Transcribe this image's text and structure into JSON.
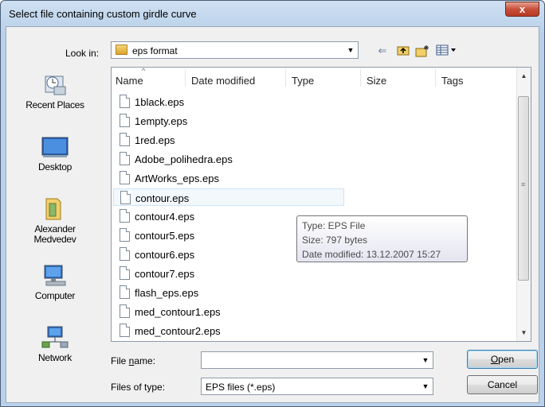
{
  "window": {
    "title": "Select file containing custom girdle curve",
    "close_glyph": "x"
  },
  "lookin": {
    "label": "Look in:",
    "value": "eps format",
    "toolbar": [
      {
        "name": "back-icon",
        "glyph": "⇐"
      },
      {
        "name": "up-folder-icon",
        "glyph": "⮤"
      },
      {
        "name": "new-folder-icon",
        "glyph": "✱"
      },
      {
        "name": "view-menu-icon",
        "glyph": "▦▾"
      }
    ]
  },
  "places": [
    {
      "label": "Recent Places",
      "icon": "recent-places-icon"
    },
    {
      "label": "Desktop",
      "icon": "desktop-icon"
    },
    {
      "label": "Alexander\nMedvedev",
      "icon": "user-folder-icon"
    },
    {
      "label": "Computer",
      "icon": "computer-icon"
    },
    {
      "label": "Network",
      "icon": "network-icon"
    }
  ],
  "columns": [
    "Name",
    "Date modified",
    "Type",
    "Size",
    "Tags"
  ],
  "files": [
    "1black.eps",
    "1empty.eps",
    "1red.eps",
    "Adobe_polihedra.eps",
    "ArtWorks_eps.eps",
    "contour.eps",
    "contour4.eps",
    "contour5.eps",
    "contour6.eps",
    "contour7.eps",
    "flash_eps.eps",
    "med_contour1.eps",
    "med_contour2.eps"
  ],
  "selected_index": 5,
  "tooltip": {
    "type": "Type: EPS File",
    "size": "Size: 797 bytes",
    "date": "Date modified: 13.12.2007 15:27"
  },
  "filename": {
    "label": "File name:",
    "value": ""
  },
  "filetype": {
    "label": "Files of type:",
    "value": "EPS files (*.eps)"
  },
  "buttons": {
    "open": "Open",
    "cancel": "Cancel"
  },
  "colors": {
    "title_gradient": "#b9d1ea",
    "close_button": "#c7503a",
    "selection": "#cfe3f7"
  }
}
